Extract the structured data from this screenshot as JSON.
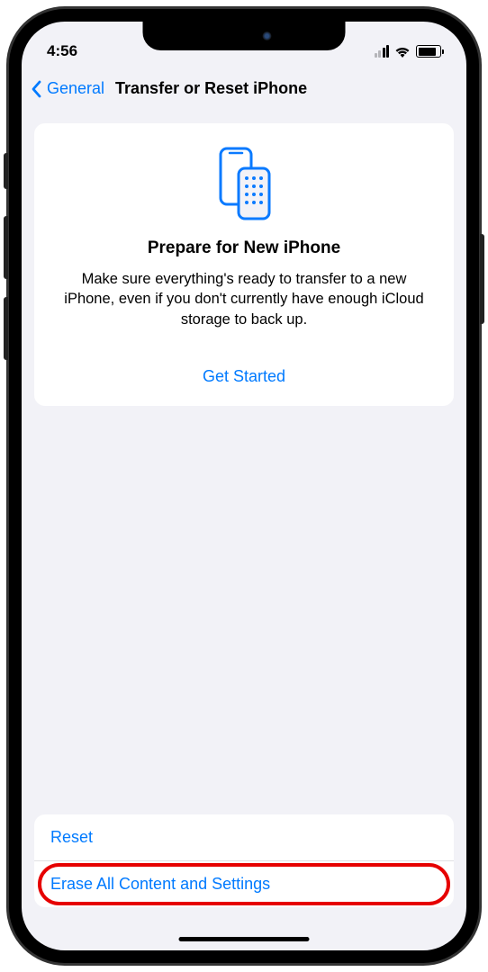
{
  "status": {
    "time": "4:56"
  },
  "nav": {
    "back_label": "General",
    "title": "Transfer or Reset iPhone"
  },
  "prepare_card": {
    "title": "Prepare for New iPhone",
    "description": "Make sure everything's ready to transfer to a new iPhone, even if you don't currently have enough iCloud storage to back up.",
    "cta": "Get Started"
  },
  "options": {
    "reset": "Reset",
    "erase": "Erase All Content and Settings"
  }
}
